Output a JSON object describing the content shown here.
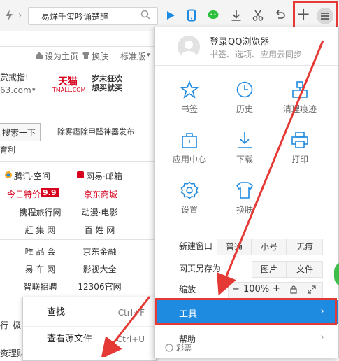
{
  "toolbar": {
    "address_text": "易烊千玺吟诵楚辞",
    "plus_label": "+"
  },
  "background_page": {
    "top_links": [
      "设为主页",
      "换肤",
      "标准版"
    ],
    "left_fragment1": "赏戒指!",
    "left_fragment2": "63.com",
    "tmall_logo": "天猫",
    "tmall_sub": "TMALL.COM",
    "tmall_ad": "岁末狂欢 想买就买",
    "search_button": "搜索一下",
    "news_line": "除雾霾除甲醛神器发布",
    "left_fragment3": "育利",
    "grid_links": [
      [
        "腾讯·空间",
        "网易·邮箱"
      ],
      [
        "今日特价",
        "京东商城"
      ],
      [
        "携程旅行网",
        "动漫·电影"
      ],
      [
        "赶 集 网",
        "百 姓 网"
      ],
      [
        "唯 品 会",
        "京东金融"
      ],
      [
        "易 车 网",
        "影视大全"
      ],
      [
        "智联招聘",
        "12306官网"
      ]
    ],
    "badge_99": "9.9",
    "bottom_fragment1": "资理财",
    "bottom_fragment2": "行",
    "bottom_fragment3": "极",
    "bottom_fragment4": "彩票"
  },
  "context_menu": {
    "items": [
      {
        "label": "查找",
        "shortcut": "Ctrl+F"
      },
      {
        "label": "查看源文件",
        "shortcut": "Ctrl+U"
      }
    ]
  },
  "main_menu": {
    "login_title": "登录QQ浏览器",
    "login_subtitle": "书签、选项、应用云同步",
    "grid": [
      {
        "label": "书签",
        "icon": "star-icon"
      },
      {
        "label": "历史",
        "icon": "clock-icon"
      },
      {
        "label": "清理痕迹",
        "icon": "broom-icon"
      },
      {
        "label": "应用中心",
        "icon": "bag-icon"
      },
      {
        "label": "下载",
        "icon": "download-icon"
      },
      {
        "label": "打印",
        "icon": "printer-icon"
      },
      {
        "label": "设置",
        "icon": "gear-icon"
      },
      {
        "label": "换肤",
        "icon": "shirt-icon"
      }
    ],
    "new_window": {
      "label": "新建窗口",
      "options": [
        "普通",
        "小号",
        "无痕"
      ]
    },
    "save_as": {
      "label": "网页另存为",
      "options": [
        "图片",
        "文件"
      ]
    },
    "zoom": {
      "label": "缩放",
      "minus": "−",
      "value": "100%",
      "plus": "+"
    },
    "tools": {
      "label": "工具",
      "chevron": "›"
    },
    "help": {
      "label": "帮助",
      "chevron": "›"
    }
  },
  "colors": {
    "accent_blue": "#1e8ae0",
    "highlight_red": "#e53935",
    "tmall_red": "#d6001c"
  }
}
